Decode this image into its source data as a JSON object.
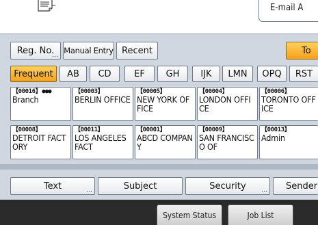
{
  "header": {
    "email_label": "E-mail A"
  },
  "entry_buttons": [
    {
      "label": "Reg. No.",
      "name": "reg-no-button"
    },
    {
      "label": "Manual Entry",
      "name": "manual-entry-button"
    },
    {
      "label": "Recent",
      "name": "recent-button"
    }
  ],
  "to_button": {
    "label": "To"
  },
  "index_tabs": [
    {
      "label": "Frequent",
      "active": true
    },
    {
      "label": "AB"
    },
    {
      "label": "CD"
    },
    {
      "label": "EF"
    },
    {
      "label": "GH"
    },
    {
      "label": "IJK"
    },
    {
      "label": "LMN"
    },
    {
      "label": "OPQ"
    },
    {
      "label": "RST"
    }
  ],
  "destinations": [
    {
      "num": "【00016】",
      "name": "Branch",
      "group": true
    },
    {
      "num": "【00003】",
      "name": "BERLIN OFFICE"
    },
    {
      "num": "【00005】",
      "name": "NEW YORK OFFICE"
    },
    {
      "num": "【00004】",
      "name": "LONDON OFFICE"
    },
    {
      "num": "【00006】",
      "name": "TORONTO OFFICE"
    },
    {
      "num": "【00008】",
      "name": "DETROIT FACTORY"
    },
    {
      "num": "【00011】",
      "name": "LOS ANGELES FACT"
    },
    {
      "num": "【00001】",
      "name": "ABCD COMPANY"
    },
    {
      "num": "【00009】",
      "name": "SAN FRANCISCO OF"
    },
    {
      "num": "【00013】",
      "name": "Admin"
    }
  ],
  "bottom_buttons": [
    {
      "label": "Text",
      "has_more": true
    },
    {
      "label": "Subject",
      "has_more": false
    },
    {
      "label": "Security",
      "has_more": true
    },
    {
      "label": "Sender N",
      "has_more": false
    }
  ],
  "status_bar": {
    "system_status": "System Status",
    "job_list": "Job List"
  },
  "colors": {
    "panel": "#cfd6df",
    "active_tab": "#f5a018",
    "status_bar": "#2a2a2a"
  }
}
